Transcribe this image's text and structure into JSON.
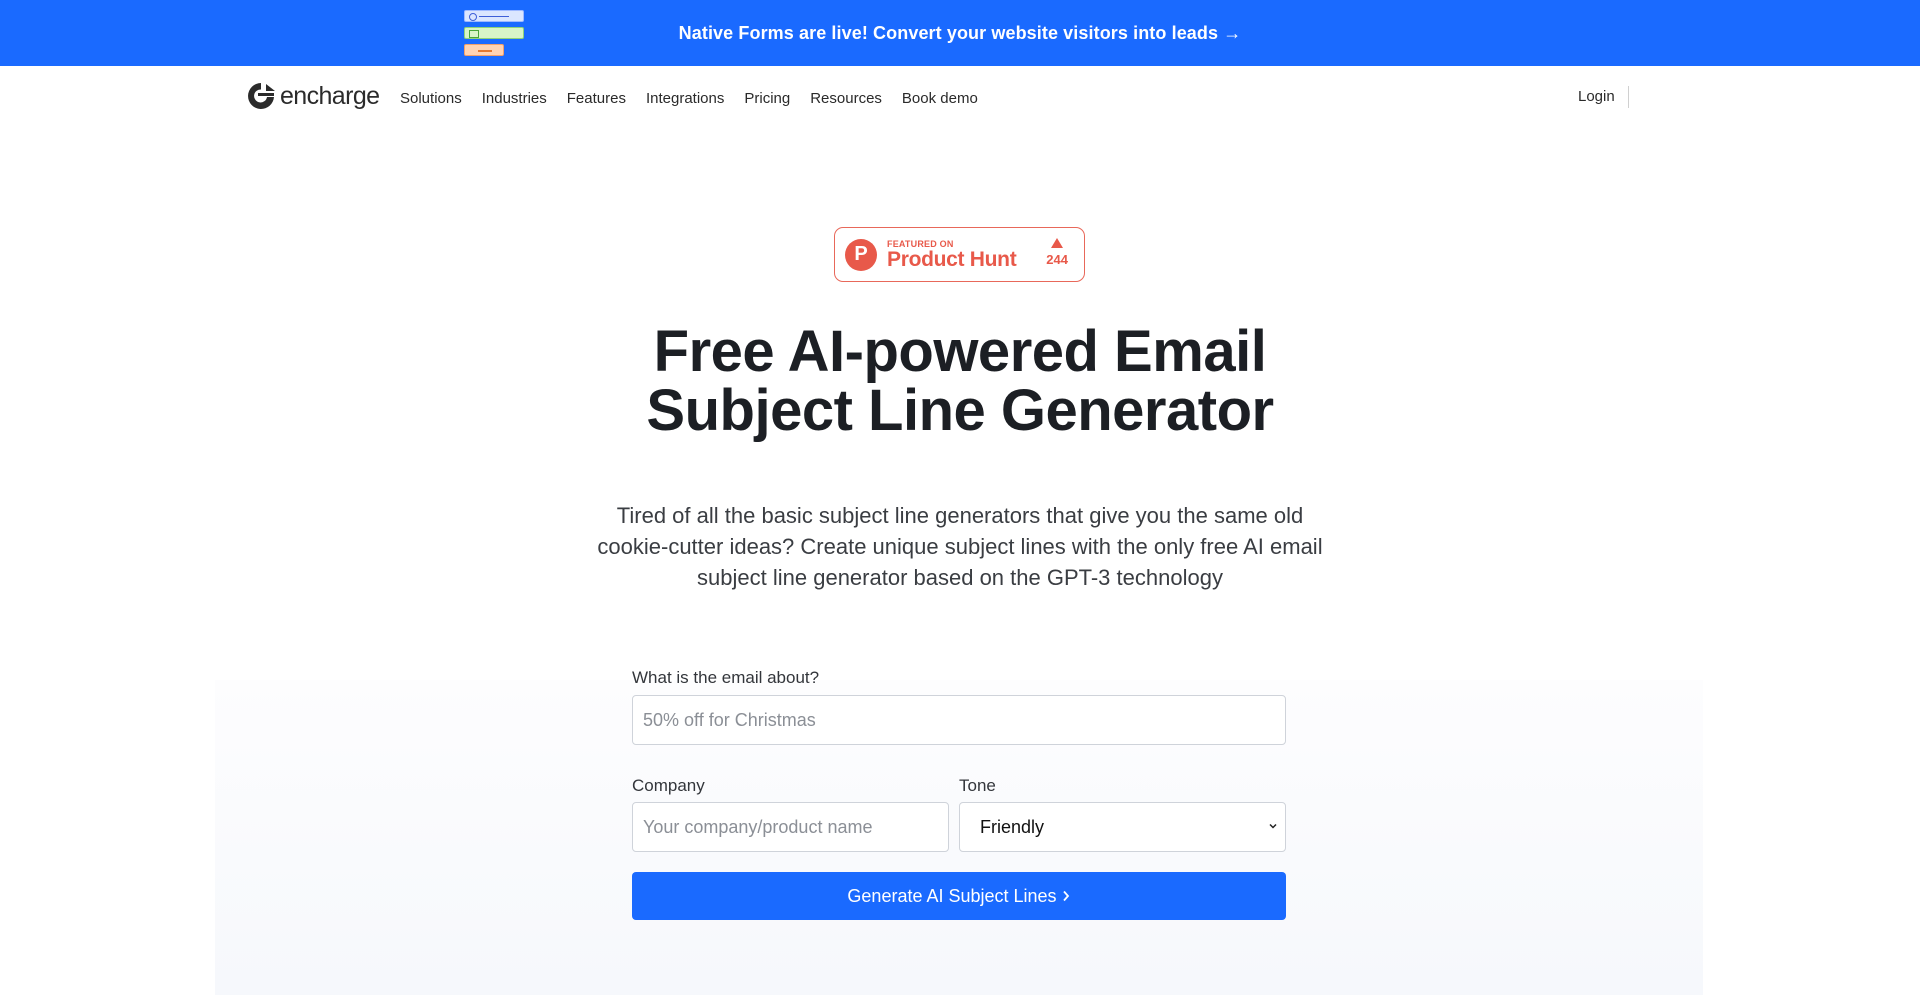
{
  "announcement": {
    "text": "Native Forms are live! Convert your website visitors into leads →",
    "graphic": "form-illustration-icon"
  },
  "nav": {
    "logo_text": "encharge",
    "items": [
      {
        "label": "Solutions"
      },
      {
        "label": "Industries"
      },
      {
        "label": "Features"
      },
      {
        "label": "Integrations"
      },
      {
        "label": "Pricing"
      },
      {
        "label": "Resources"
      },
      {
        "label": "Book demo"
      }
    ],
    "login_label": "Login"
  },
  "product_hunt": {
    "logo_letter": "P",
    "featured_label": "FEATURED ON",
    "name": "Product Hunt",
    "votes": "244"
  },
  "hero": {
    "title_line1": "Free AI-powered Email",
    "title_line2": "Subject Line Generator",
    "subtitle": "Tired of all the basic subject line generators that give you the same old cookie-cutter ideas? Create unique subject lines with the only free AI email subject line generator based on the GPT-3 technology"
  },
  "form": {
    "about_label": "What is the email about?",
    "about_value": "",
    "about_placeholder": "50% off for Christmas",
    "company_label": "Company",
    "company_value": "",
    "company_placeholder": "Your company/product name",
    "tone_label": "Tone",
    "tone_selected": "Friendly",
    "submit_label": "Generate AI Subject Lines"
  },
  "colors": {
    "brand_blue": "#1a6aff",
    "product_hunt_red": "#e8594a",
    "heading": "#1c1f24"
  }
}
